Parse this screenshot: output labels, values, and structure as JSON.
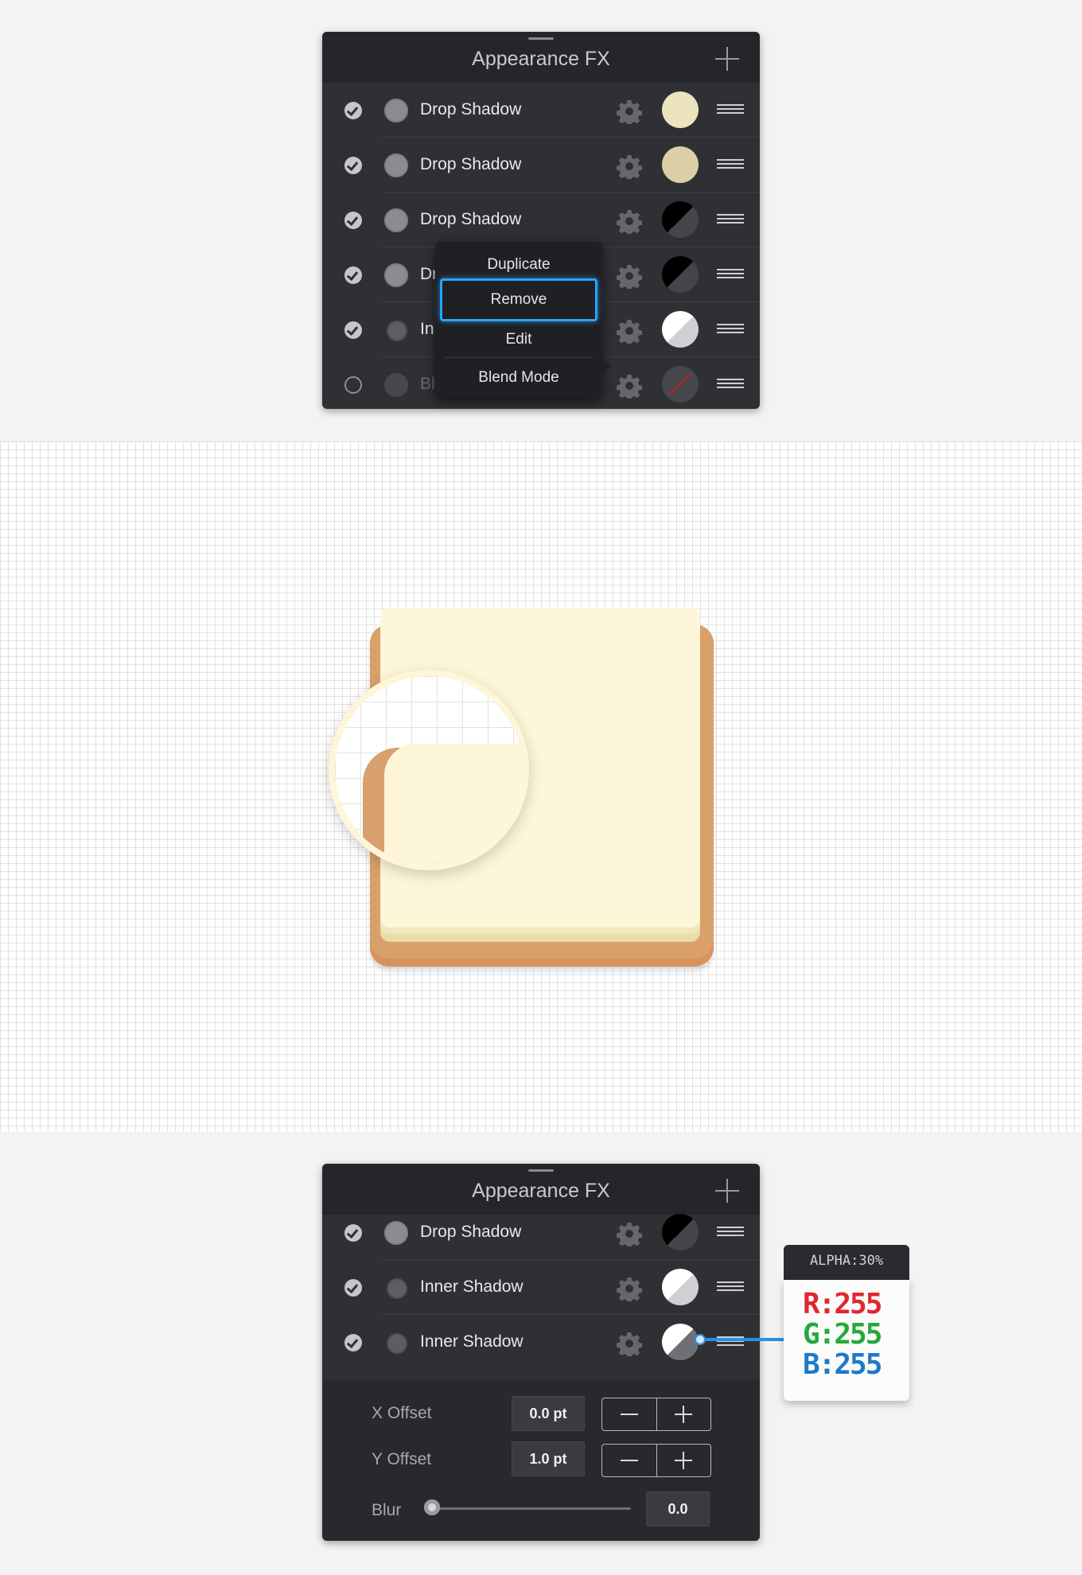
{
  "top_panel": {
    "title": "Appearance FX",
    "rows": [
      {
        "enabled": true,
        "label": "Drop Shadow",
        "swatch": "cream"
      },
      {
        "enabled": true,
        "label": "Drop Shadow",
        "swatch": "tan"
      },
      {
        "enabled": true,
        "label": "Drop Shadow",
        "swatch": "black-half"
      },
      {
        "enabled": true,
        "label": "Dr",
        "swatch": "black-half"
      },
      {
        "enabled": true,
        "label": "In",
        "swatch": "white-half"
      },
      {
        "enabled": false,
        "label": "Bl",
        "swatch": "none-red-slash"
      }
    ]
  },
  "context_menu": {
    "items": [
      "Duplicate",
      "Remove",
      "Edit",
      "Blend Mode"
    ],
    "highlighted": "Remove"
  },
  "bottom_panel": {
    "title": "Appearance FX",
    "rows": [
      {
        "enabled": true,
        "label": "Drop Shadow",
        "swatch": "black-half"
      },
      {
        "enabled": true,
        "label": "Inner Shadow",
        "swatch": "white-half"
      },
      {
        "enabled": true,
        "label": "Inner Shadow",
        "swatch": "white-gray-half"
      }
    ],
    "settings": {
      "x_offset_label": "X Offset",
      "x_offset_value": "0.0 pt",
      "y_offset_label": "Y Offset",
      "y_offset_value": "1.0 pt",
      "blur_label": "Blur",
      "blur_value": "0.0",
      "blur_level": 0
    }
  },
  "color_callout": {
    "alpha": "ALPHA:30%",
    "r": "R:255",
    "g": "G:255",
    "b": "B:255"
  },
  "colors": {
    "panel_bg": "#2f3034",
    "header_bg": "#252629",
    "highlight": "#2aa3ff",
    "tile_orange": "#d9a06a",
    "tile_paper": "#fef6d8"
  }
}
